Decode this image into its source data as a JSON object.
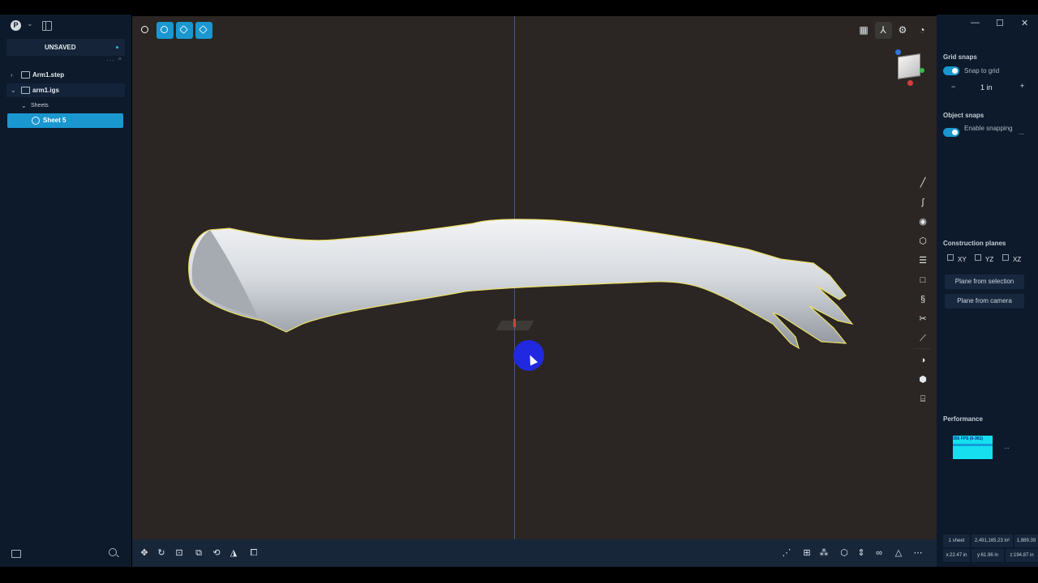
{
  "app": {
    "user_initial": "P",
    "document_status": "UNSAVED"
  },
  "tree": {
    "items": [
      {
        "label": "Arm1.step"
      },
      {
        "label": "arm1.igs"
      },
      {
        "label": "Sheets"
      },
      {
        "label": "Sheet 5"
      }
    ]
  },
  "viewport": {
    "background": "#2b2623",
    "axis_color": "#3f5d7e",
    "model_outline": "#e9de67"
  },
  "right_panel": {
    "grid_snaps": {
      "title": "Grid snaps",
      "toggle_label": "Snap to grid",
      "value": "1 in",
      "minus": "−",
      "plus": "+"
    },
    "object_snaps": {
      "title": "Object snaps",
      "toggle_label": "Enable snapping",
      "more": "..."
    },
    "construction_planes": {
      "title": "Construction planes",
      "planes": [
        "XY",
        "YZ",
        "XZ"
      ],
      "from_selection": "Plane from selection",
      "from_camera": "Plane from camera"
    },
    "performance": {
      "title": "Performance",
      "fps": "356 FPS (0-361)",
      "more": "..."
    },
    "stats": {
      "sheets": "1 sheet",
      "area": "2,491,165.23 in²",
      "volume": "1,889.39",
      "x": "x:22.47 in",
      "y": "y:61.96 in",
      "z": "z:194.87 in"
    }
  },
  "window": {
    "minimize": "—",
    "maximize": "☐",
    "close": "✕"
  },
  "colors": {
    "accent": "#1a97cf",
    "panel": "#0d1a2b",
    "cursor_highlight": "#2029e0"
  }
}
